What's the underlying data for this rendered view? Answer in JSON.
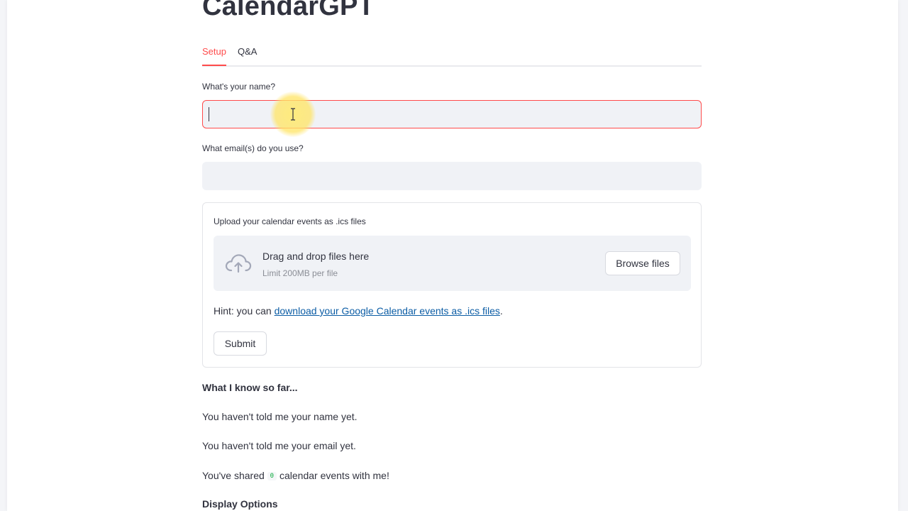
{
  "app": {
    "title": "CalendarGPT"
  },
  "tabs": [
    {
      "label": "Setup",
      "active": true
    },
    {
      "label": "Q&A",
      "active": false
    }
  ],
  "colors": {
    "accent": "#ff4b4b",
    "link": "#0c5da5",
    "code": "#09ab3b",
    "input_bg": "#f0f2f6"
  },
  "form": {
    "name_label": "What's your name?",
    "name_value": "",
    "email_label": "What email(s) do you use?",
    "email_value": "",
    "upload_label": "Upload your calendar events as .ics files",
    "dropzone": {
      "icon": "cloud-upload-icon",
      "title": "Drag and drop files here",
      "limit": "Limit 200MB per file",
      "browse_label": "Browse files"
    },
    "hint_prefix": "Hint: you can ",
    "hint_link": "download your Google Calendar events as .ics files",
    "hint_suffix": ".",
    "submit_label": "Submit"
  },
  "summary": {
    "heading": "What I know so far...",
    "name_status": "You haven't told me your name yet.",
    "email_status": "You haven't told me your email yet.",
    "events_prefix": "You've shared ",
    "events_count": "0",
    "events_suffix": " calendar events with me!"
  },
  "display_options": {
    "heading": "Display Options"
  }
}
